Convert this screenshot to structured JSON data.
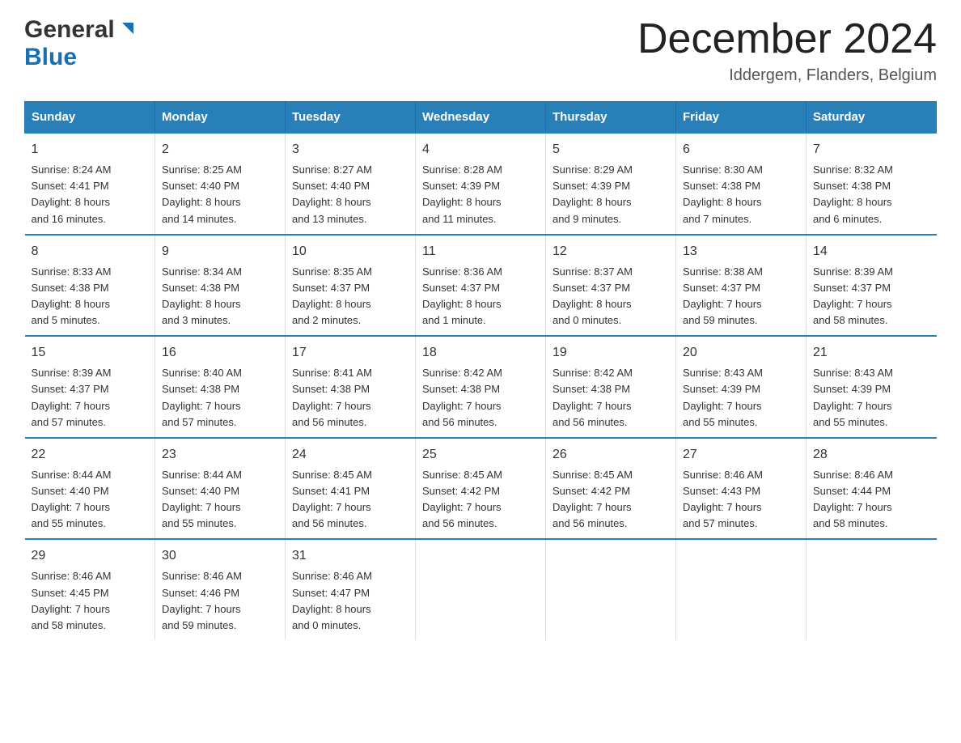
{
  "header": {
    "logo": {
      "line1": "General",
      "line2": "Blue"
    },
    "title": "December 2024",
    "location": "Iddergem, Flanders, Belgium"
  },
  "days_of_week": [
    "Sunday",
    "Monday",
    "Tuesday",
    "Wednesday",
    "Thursday",
    "Friday",
    "Saturday"
  ],
  "weeks": [
    [
      {
        "day": "1",
        "sunrise": "8:24 AM",
        "sunset": "4:41 PM",
        "daylight": "8 hours and 16 minutes."
      },
      {
        "day": "2",
        "sunrise": "8:25 AM",
        "sunset": "4:40 PM",
        "daylight": "8 hours and 14 minutes."
      },
      {
        "day": "3",
        "sunrise": "8:27 AM",
        "sunset": "4:40 PM",
        "daylight": "8 hours and 13 minutes."
      },
      {
        "day": "4",
        "sunrise": "8:28 AM",
        "sunset": "4:39 PM",
        "daylight": "8 hours and 11 minutes."
      },
      {
        "day": "5",
        "sunrise": "8:29 AM",
        "sunset": "4:39 PM",
        "daylight": "8 hours and 9 minutes."
      },
      {
        "day": "6",
        "sunrise": "8:30 AM",
        "sunset": "4:38 PM",
        "daylight": "8 hours and 7 minutes."
      },
      {
        "day": "7",
        "sunrise": "8:32 AM",
        "sunset": "4:38 PM",
        "daylight": "8 hours and 6 minutes."
      }
    ],
    [
      {
        "day": "8",
        "sunrise": "8:33 AM",
        "sunset": "4:38 PM",
        "daylight": "8 hours and 5 minutes."
      },
      {
        "day": "9",
        "sunrise": "8:34 AM",
        "sunset": "4:38 PM",
        "daylight": "8 hours and 3 minutes."
      },
      {
        "day": "10",
        "sunrise": "8:35 AM",
        "sunset": "4:37 PM",
        "daylight": "8 hours and 2 minutes."
      },
      {
        "day": "11",
        "sunrise": "8:36 AM",
        "sunset": "4:37 PM",
        "daylight": "8 hours and 1 minute."
      },
      {
        "day": "12",
        "sunrise": "8:37 AM",
        "sunset": "4:37 PM",
        "daylight": "8 hours and 0 minutes."
      },
      {
        "day": "13",
        "sunrise": "8:38 AM",
        "sunset": "4:37 PM",
        "daylight": "7 hours and 59 minutes."
      },
      {
        "day": "14",
        "sunrise": "8:39 AM",
        "sunset": "4:37 PM",
        "daylight": "7 hours and 58 minutes."
      }
    ],
    [
      {
        "day": "15",
        "sunrise": "8:39 AM",
        "sunset": "4:37 PM",
        "daylight": "7 hours and 57 minutes."
      },
      {
        "day": "16",
        "sunrise": "8:40 AM",
        "sunset": "4:38 PM",
        "daylight": "7 hours and 57 minutes."
      },
      {
        "day": "17",
        "sunrise": "8:41 AM",
        "sunset": "4:38 PM",
        "daylight": "7 hours and 56 minutes."
      },
      {
        "day": "18",
        "sunrise": "8:42 AM",
        "sunset": "4:38 PM",
        "daylight": "7 hours and 56 minutes."
      },
      {
        "day": "19",
        "sunrise": "8:42 AM",
        "sunset": "4:38 PM",
        "daylight": "7 hours and 56 minutes."
      },
      {
        "day": "20",
        "sunrise": "8:43 AM",
        "sunset": "4:39 PM",
        "daylight": "7 hours and 55 minutes."
      },
      {
        "day": "21",
        "sunrise": "8:43 AM",
        "sunset": "4:39 PM",
        "daylight": "7 hours and 55 minutes."
      }
    ],
    [
      {
        "day": "22",
        "sunrise": "8:44 AM",
        "sunset": "4:40 PM",
        "daylight": "7 hours and 55 minutes."
      },
      {
        "day": "23",
        "sunrise": "8:44 AM",
        "sunset": "4:40 PM",
        "daylight": "7 hours and 55 minutes."
      },
      {
        "day": "24",
        "sunrise": "8:45 AM",
        "sunset": "4:41 PM",
        "daylight": "7 hours and 56 minutes."
      },
      {
        "day": "25",
        "sunrise": "8:45 AM",
        "sunset": "4:42 PM",
        "daylight": "7 hours and 56 minutes."
      },
      {
        "day": "26",
        "sunrise": "8:45 AM",
        "sunset": "4:42 PM",
        "daylight": "7 hours and 56 minutes."
      },
      {
        "day": "27",
        "sunrise": "8:46 AM",
        "sunset": "4:43 PM",
        "daylight": "7 hours and 57 minutes."
      },
      {
        "day": "28",
        "sunrise": "8:46 AM",
        "sunset": "4:44 PM",
        "daylight": "7 hours and 58 minutes."
      }
    ],
    [
      {
        "day": "29",
        "sunrise": "8:46 AM",
        "sunset": "4:45 PM",
        "daylight": "7 hours and 58 minutes."
      },
      {
        "day": "30",
        "sunrise": "8:46 AM",
        "sunset": "4:46 PM",
        "daylight": "7 hours and 59 minutes."
      },
      {
        "day": "31",
        "sunrise": "8:46 AM",
        "sunset": "4:47 PM",
        "daylight": "8 hours and 0 minutes."
      },
      null,
      null,
      null,
      null
    ]
  ],
  "labels": {
    "sunrise": "Sunrise:",
    "sunset": "Sunset:",
    "daylight": "Daylight:"
  }
}
